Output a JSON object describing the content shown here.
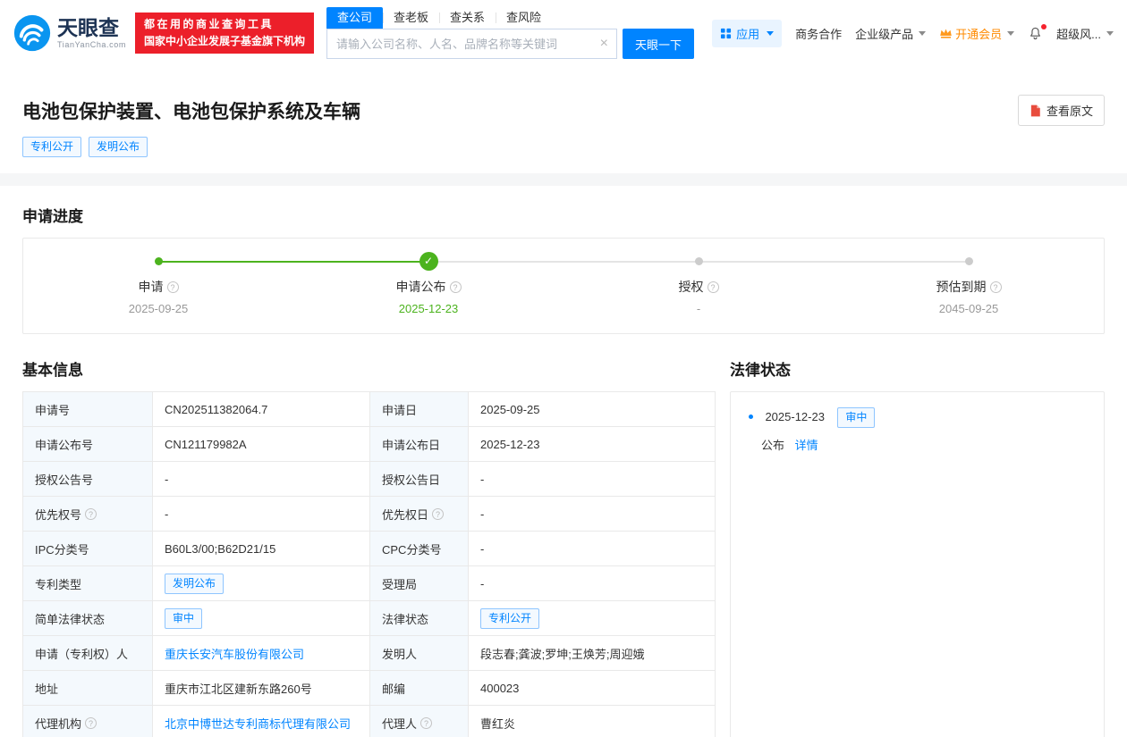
{
  "header": {
    "logo": {
      "brand": "天眼查",
      "domain": "TianYanCha.com"
    },
    "badge": {
      "line1": "都在用的商业查询工具",
      "line2": "国家中小企业发展子基金旗下机构"
    },
    "search_tabs": [
      {
        "label": "查公司",
        "active": true
      },
      {
        "label": "查老板",
        "active": false
      },
      {
        "label": "查关系",
        "active": false
      },
      {
        "label": "查风险",
        "active": false
      }
    ],
    "search": {
      "placeholder": "请输入公司名称、人名、品牌名称等关键词",
      "button": "天眼一下"
    },
    "nav": {
      "apps": "应用",
      "cooperation": "商务合作",
      "enterprise": "企业级产品",
      "vip": "开通会员",
      "risk": "超级风..."
    }
  },
  "title": {
    "text": "电池包保护装置、电池包保护系统及车辆",
    "tags": [
      "专利公开",
      "发明公布"
    ],
    "view_original": "查看原文"
  },
  "progress": {
    "heading": "申请进度",
    "steps": [
      {
        "label": "申请",
        "date": "2025-09-25",
        "state": "done"
      },
      {
        "label": "申请公布",
        "date": "2025-12-23",
        "state": "current"
      },
      {
        "label": "授权",
        "date": "-",
        "state": "pending"
      },
      {
        "label": "预估到期",
        "date": "2045-09-25",
        "state": "pending"
      }
    ]
  },
  "basic_info": {
    "heading": "基本信息",
    "rows": [
      {
        "l_label": "申请号",
        "l_value": "CN202511382064.7",
        "r_label": "申请日",
        "r_value": "2025-09-25"
      },
      {
        "l_label": "申请公布号",
        "l_value": "CN121179982A",
        "r_label": "申请公布日",
        "r_value": "2025-12-23"
      },
      {
        "l_label": "授权公告号",
        "l_value": "-",
        "r_label": "授权公告日",
        "r_value": "-"
      },
      {
        "l_label": "优先权号",
        "l_value": "-",
        "r_label": "优先权日",
        "r_value": "-"
      },
      {
        "l_label": "IPC分类号",
        "l_value": "B60L3/00;B62D21/15",
        "r_label": "CPC分类号",
        "r_value": "-"
      },
      {
        "l_label": "专利类型",
        "l_value": "发明公布",
        "r_label": "受理局",
        "r_value": "-"
      },
      {
        "l_label": "简单法律状态",
        "l_value": "审中",
        "r_label": "法律状态",
        "r_value": "专利公开"
      },
      {
        "l_label": "申请（专利权）人",
        "l_value": "重庆长安汽车股份有限公司",
        "r_label": "发明人",
        "r_value": "段志春;龚波;罗坤;王焕芳;周迎娥"
      },
      {
        "l_label": "地址",
        "l_value": "重庆市江北区建新东路260号",
        "r_label": "邮编",
        "r_value": "400023"
      },
      {
        "l_label": "代理机构",
        "l_value": "北京中博世达专利商标代理有限公司",
        "r_label": "代理人",
        "r_value": "曹红炎"
      }
    ]
  },
  "legal_status": {
    "heading": "法律状态",
    "items": [
      {
        "date": "2025-12-23",
        "tag": "审中",
        "action": "公布",
        "detail": "详情"
      }
    ]
  },
  "icons": {
    "logo": "tianyancha-swirl-logo",
    "apps": "grid-icon",
    "vip": "crown-icon",
    "notification": "bell-icon",
    "view_original": "pdf-file-icon",
    "help": "question-mark-circle-icon",
    "clear": "close-icon",
    "current_step": "check-icon",
    "dropdown": "chevron-down-icon"
  },
  "colors": {
    "primary_blue": "#0084ff",
    "brand_red": "#ec1f2a",
    "vip_orange": "#ff8a00",
    "progress_green": "#4cb31e"
  }
}
